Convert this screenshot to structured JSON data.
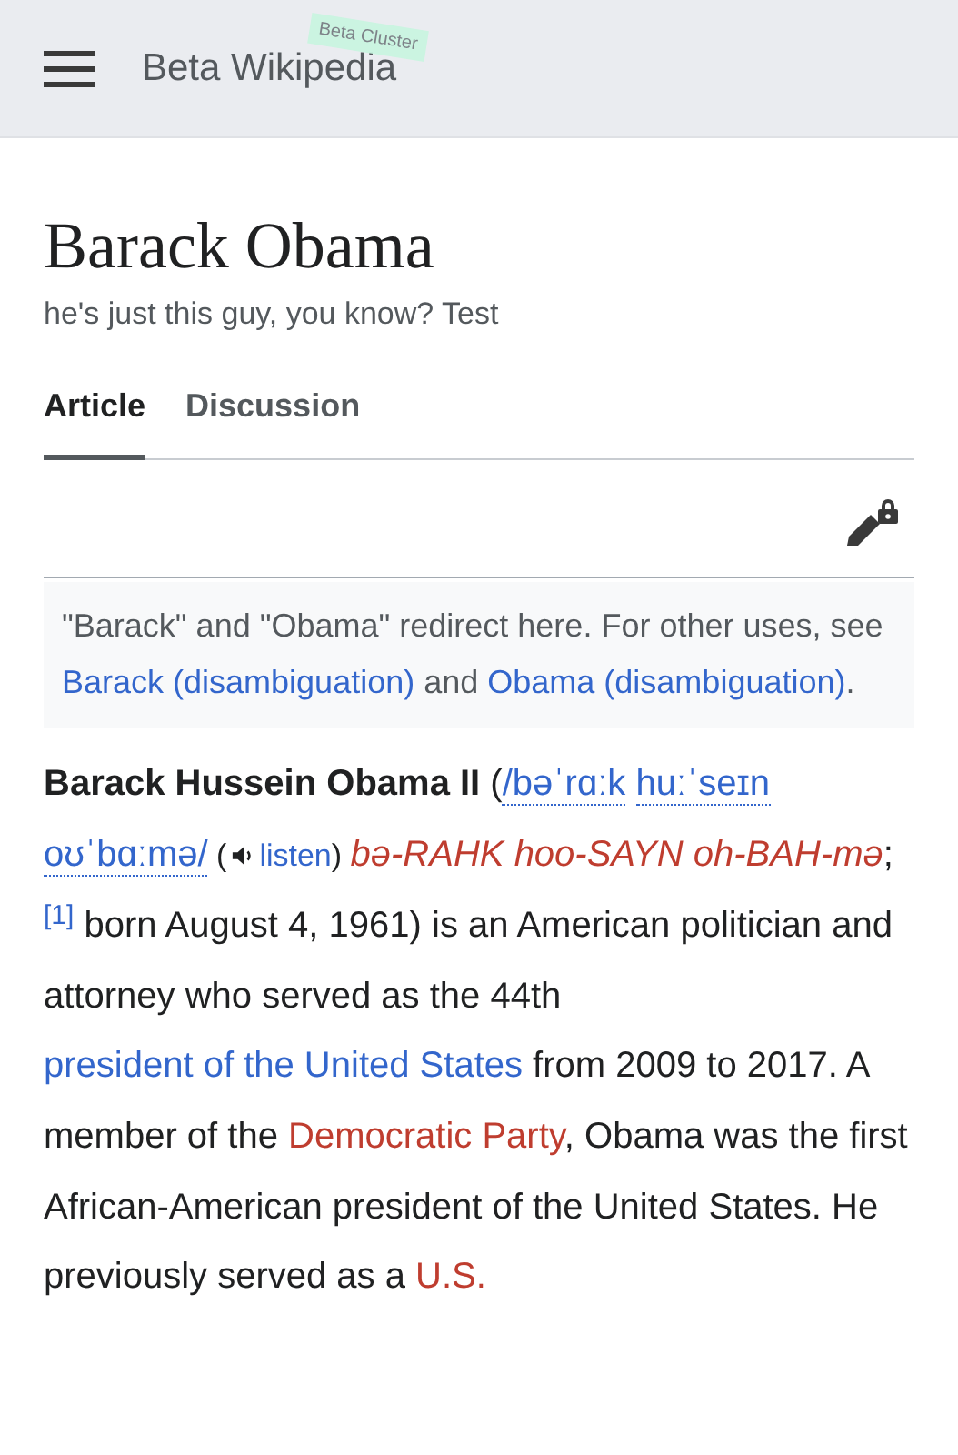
{
  "header": {
    "title": "Beta Wikipedia",
    "badge": "Beta Cluster"
  },
  "page": {
    "title": "Barack Obama",
    "subtitle": "he's just this guy, you know? Test",
    "tabs": [
      {
        "label": "Article",
        "selected": true
      },
      {
        "label": "Discussion",
        "selected": false
      }
    ],
    "hatnote": [
      {
        "kind": "plain",
        "text": "\"Barack\" and \"Obama\" redirect here. For other uses, see "
      },
      {
        "kind": "link",
        "text": "Barack (disambiguation)"
      },
      {
        "kind": "plain",
        "text": " and "
      },
      {
        "kind": "link",
        "text": "Obama (disambiguation)"
      },
      {
        "kind": "plain",
        "text": "."
      }
    ],
    "lead": [
      {
        "kind": "bold",
        "text": "Barack Hussein Obama II"
      },
      {
        "kind": "plain",
        "text": " ("
      },
      {
        "kind": "ipa",
        "parts": [
          "/bəˈrɑːk",
          "huːˈseɪn",
          "oʊˈbɑːmə/"
        ]
      },
      {
        "kind": "small",
        "text": " ("
      },
      {
        "kind": "audio",
        "text": "listen"
      },
      {
        "kind": "small",
        "text": ") "
      },
      {
        "kind": "respell",
        "parts": [
          "bə-RAHK",
          "hoo-SAYN",
          "oh-BAH-mə"
        ]
      },
      {
        "kind": "plain",
        "text": ";"
      },
      {
        "kind": "ref",
        "text": "[1]"
      },
      {
        "kind": "plain",
        "text": " born August 4, 1961) is an American politician and attorney who served as the 44th "
      },
      {
        "kind": "link",
        "text": "president of the United States"
      },
      {
        "kind": "plain",
        "text": " from 2009 to 2017. A member of the "
      },
      {
        "kind": "redlink",
        "text": "Democratic Party"
      },
      {
        "kind": "plain",
        "text": ", Obama was the first African-American president of the United States. He previously served as a "
      },
      {
        "kind": "redlink",
        "text": "U.S."
      }
    ]
  }
}
